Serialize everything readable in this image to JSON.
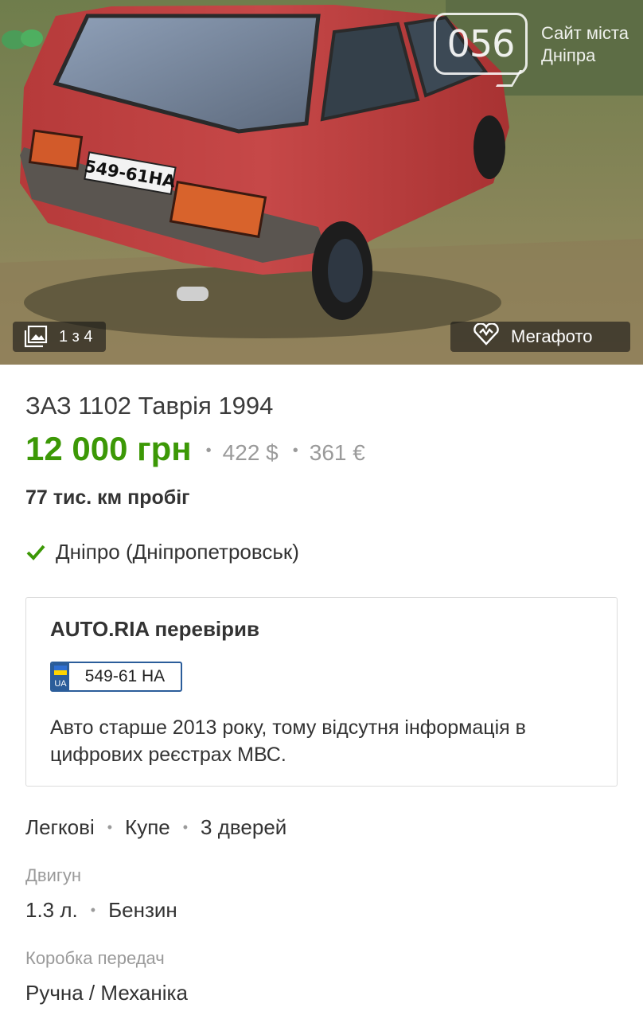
{
  "photo": {
    "plate_text": "549-61HA",
    "watermark_logo": "056",
    "watermark_text_line1": "Сайт міста",
    "watermark_text_line2": "Дніпра",
    "counter_icon": "gallery-icon",
    "counter_text": "1 з 4",
    "megafoto_icon": "megafoto-heart-icon",
    "megafoto_label": "Мегафото"
  },
  "listing": {
    "title": "ЗАЗ 1102 Таврія 1994",
    "price_uah": "12 000 грн",
    "price_usd": "422 $",
    "price_eur": "361 €",
    "separator": "•",
    "mileage": "77 тис. км пробіг",
    "location": "Дніпро (Дніпропетровськ)",
    "accent_color": "#3c9806"
  },
  "verification": {
    "title": "AUTO.RIA перевірив",
    "plate_country": "UA",
    "plate_number": "549-61 НА",
    "note": "Авто старше 2013 року, тому відсутня інформація в цифрових реєстрах МВС."
  },
  "specs": {
    "body": [
      "Легкові",
      "Купе",
      "3 дверей"
    ],
    "engine_label": "Двигун",
    "engine": [
      "1.3 л.",
      "Бензин"
    ],
    "gearbox_label": "Коробка передач",
    "gearbox": "Ручна / Механіка"
  }
}
